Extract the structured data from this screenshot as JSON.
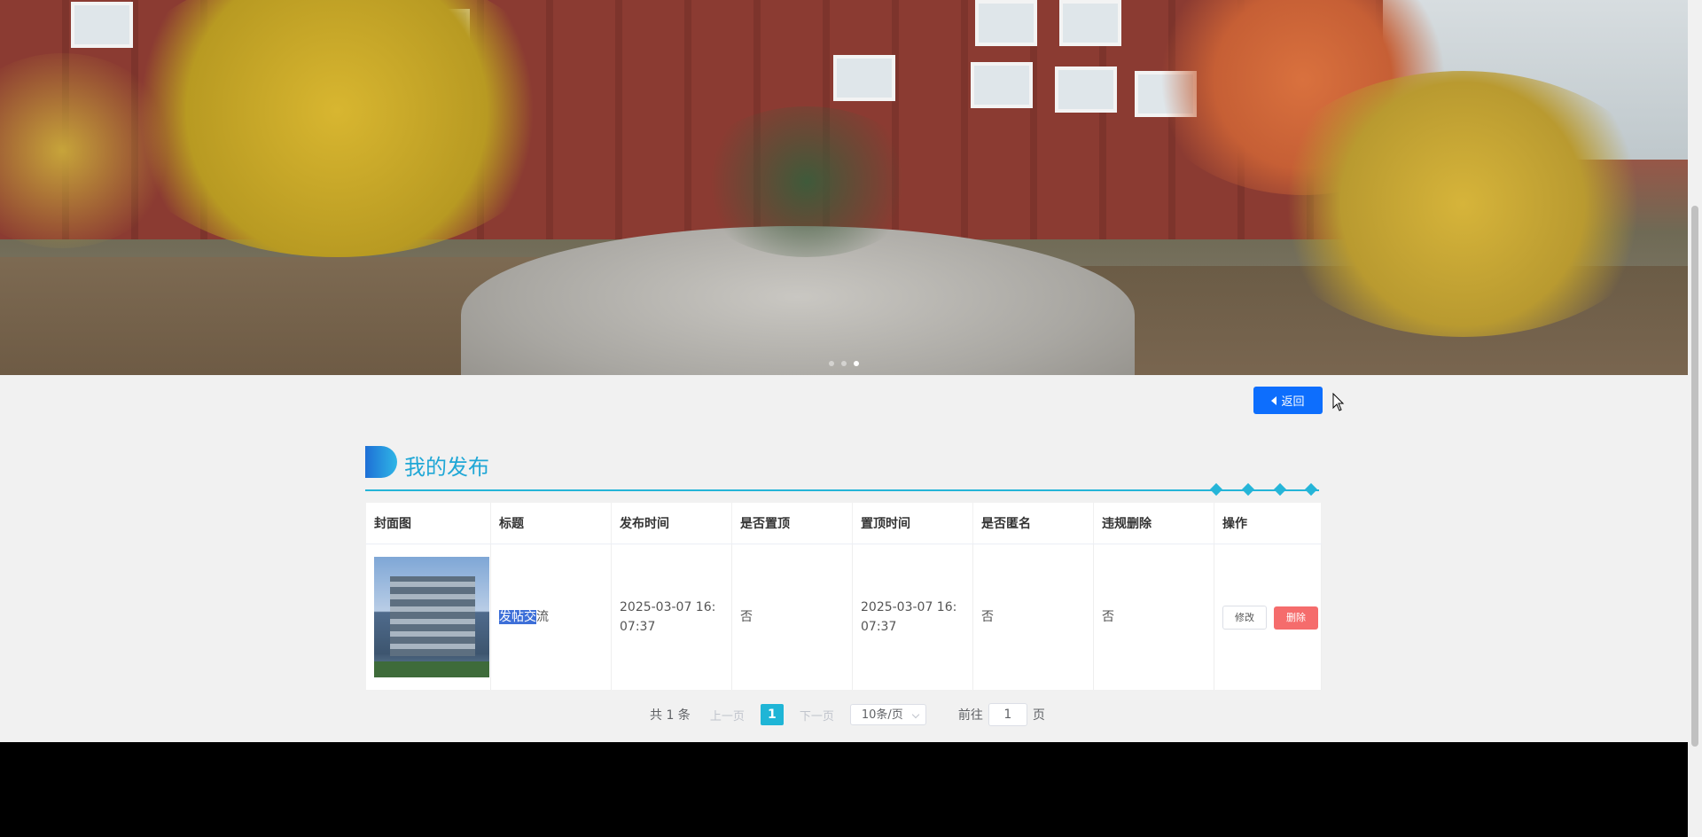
{
  "banner": {
    "carousel_dots": 3,
    "active_dot": 2
  },
  "toolbar": {
    "back_label": "返回"
  },
  "section": {
    "title": "我的发布"
  },
  "table": {
    "headers": [
      "封面图",
      "标题",
      "发布时间",
      "是否置顶",
      "置顶时间",
      "是否匿名",
      "违规删除",
      "操作"
    ],
    "rows": [
      {
        "title_selected": "发帖交",
        "title_rest": "流",
        "publish_time": "2025-03-07 16:07:37",
        "is_top": "否",
        "top_time": "2025-03-07 16:07:37",
        "is_anonymous": "否",
        "violation_deleted": "否",
        "edit_label": "修改",
        "delete_label": "删除"
      }
    ]
  },
  "pagination": {
    "total": "共 1 条",
    "prev": "上一页",
    "current": "1",
    "next": "下一页",
    "page_size": "10条/页",
    "goto_prefix": "前往",
    "goto_value": "1",
    "goto_suffix": "页"
  },
  "colors": {
    "accent": "#1fb5d6",
    "primary_button": "#0d6efd",
    "danger": "#f56c6c"
  }
}
